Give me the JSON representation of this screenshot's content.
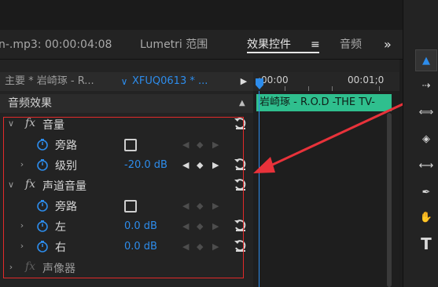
{
  "tabs": {
    "source_label": "n-.mp3: 00:00:04:08",
    "lumetri_label": "Lumetri 范围",
    "effects_label": "效果控件",
    "menu_glyph": "≡",
    "audio_label": "音频",
    "more_glyph": "»"
  },
  "source": {
    "master_label": "主要 * 岩崎琢 - R...",
    "clip_label": "XFUQ0613 * ...",
    "chevron": "∨",
    "play_glyph": "▶"
  },
  "timeline": {
    "time_start": ":00:00",
    "time_end": "00:01;0",
    "clip_label": "岩崎琢 - R.O.D -THE TV-"
  },
  "section": {
    "title": "音频效果",
    "caret": "▲"
  },
  "effects": [
    {
      "type": "group",
      "label": "音量",
      "enabled": true
    },
    {
      "type": "param",
      "label": "旁路",
      "control": "checkbox",
      "value": ""
    },
    {
      "type": "param",
      "label": "级别",
      "control": "value",
      "value": "-20.0 dB",
      "expandable": true,
      "keyframe_active": true
    },
    {
      "type": "group",
      "label": "声道音量",
      "enabled": true
    },
    {
      "type": "param",
      "label": "旁路",
      "control": "checkbox",
      "value": ""
    },
    {
      "type": "param",
      "label": "左",
      "control": "value",
      "value": "0.0 dB",
      "expandable": true,
      "keyframe_active": false
    },
    {
      "type": "param",
      "label": "右",
      "control": "value",
      "value": "0.0 dB",
      "expandable": true,
      "keyframe_active": false
    },
    {
      "type": "group",
      "label": "声像器",
      "enabled": false
    }
  ],
  "colors": {
    "accent_blue": "#2d8ceb",
    "clip_green": "#2fbf8e",
    "highlight_red": "#e22a2a",
    "arrow_red": "#e8323a"
  },
  "tools": [
    {
      "name": "selection-tool-icon",
      "glyph": "▲"
    },
    {
      "name": "track-select-tool-icon",
      "glyph": "⇢"
    },
    {
      "name": "ripple-edit-tool-icon",
      "glyph": "⟺"
    },
    {
      "name": "razor-tool-icon",
      "glyph": "◈"
    },
    {
      "name": "slip-tool-icon",
      "glyph": "⟷"
    },
    {
      "name": "pen-tool-icon",
      "glyph": "✒"
    },
    {
      "name": "hand-tool-icon",
      "glyph": "✋"
    },
    {
      "name": "type-tool-icon",
      "glyph": "T"
    }
  ]
}
